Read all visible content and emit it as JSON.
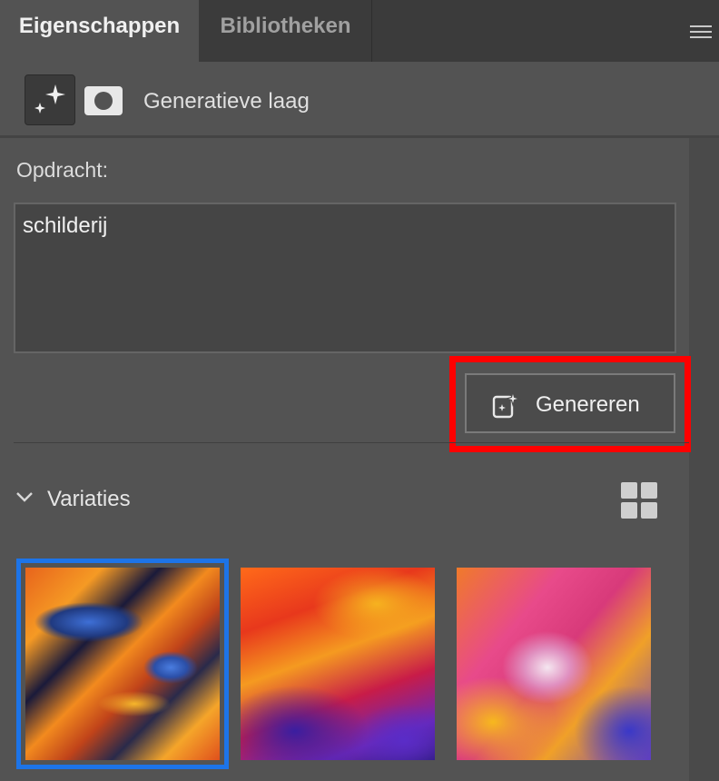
{
  "tabs": [
    {
      "label": "Eigenschappen",
      "active": true
    },
    {
      "label": "Bibliotheken",
      "active": false
    }
  ],
  "panel_menu_icon": "hamburger-menu-icon",
  "layer": {
    "type_icon": "generative-sparkle-icon",
    "mask_icon": "layer-mask-icon",
    "label": "Generatieve laag"
  },
  "prompt": {
    "label": "Opdracht:",
    "value": "schilderij"
  },
  "generate_button": {
    "label": "Genereren",
    "icon": "generate-sparkle-icon",
    "highlight_color": "#ff0000"
  },
  "variations": {
    "label": "Variaties",
    "collapse_icon": "chevron-down-icon",
    "view_icon": "grid-view-icon",
    "selected_index": 0,
    "selected_color": "#1d74e8",
    "items": [
      {
        "name": "variation-1"
      },
      {
        "name": "variation-2"
      },
      {
        "name": "variation-3"
      }
    ]
  },
  "colors": {
    "panel_bg": "#535353",
    "tabbar_bg": "#3b3b3b",
    "field_bg": "#454545"
  }
}
